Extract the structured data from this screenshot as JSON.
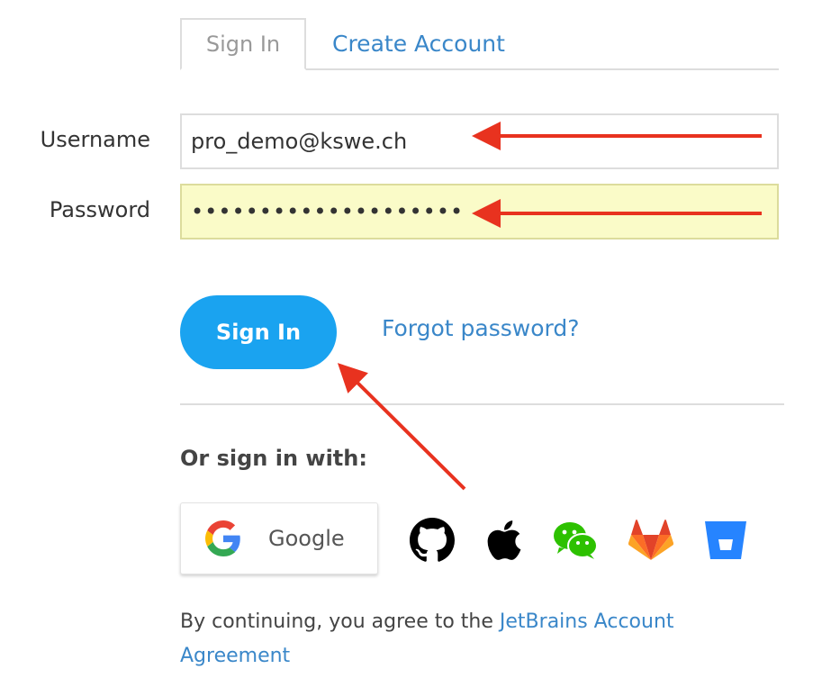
{
  "tabs": {
    "sign_in": "Sign In",
    "create_account": "Create Account"
  },
  "form": {
    "username_label": "Username",
    "username_value": "pro_demo@kswe.ch",
    "password_label": "Password",
    "password_value": "••••••••••••••••••••",
    "sign_in_button": "Sign In",
    "forgot_password": "Forgot password?"
  },
  "social": {
    "heading": "Or sign in with:",
    "google_label": "Google",
    "providers": [
      "github-icon",
      "apple-icon",
      "wechat-icon",
      "gitlab-icon",
      "bitbucket-icon"
    ]
  },
  "agreement": {
    "prefix": "By continuing, you agree to the ",
    "link": "JetBrains Account Agreement"
  },
  "colors": {
    "accent": "#1aa3f0",
    "link": "#3a87c9",
    "annotation_arrow": "#e8321f",
    "password_highlight": "#fafbc8"
  }
}
